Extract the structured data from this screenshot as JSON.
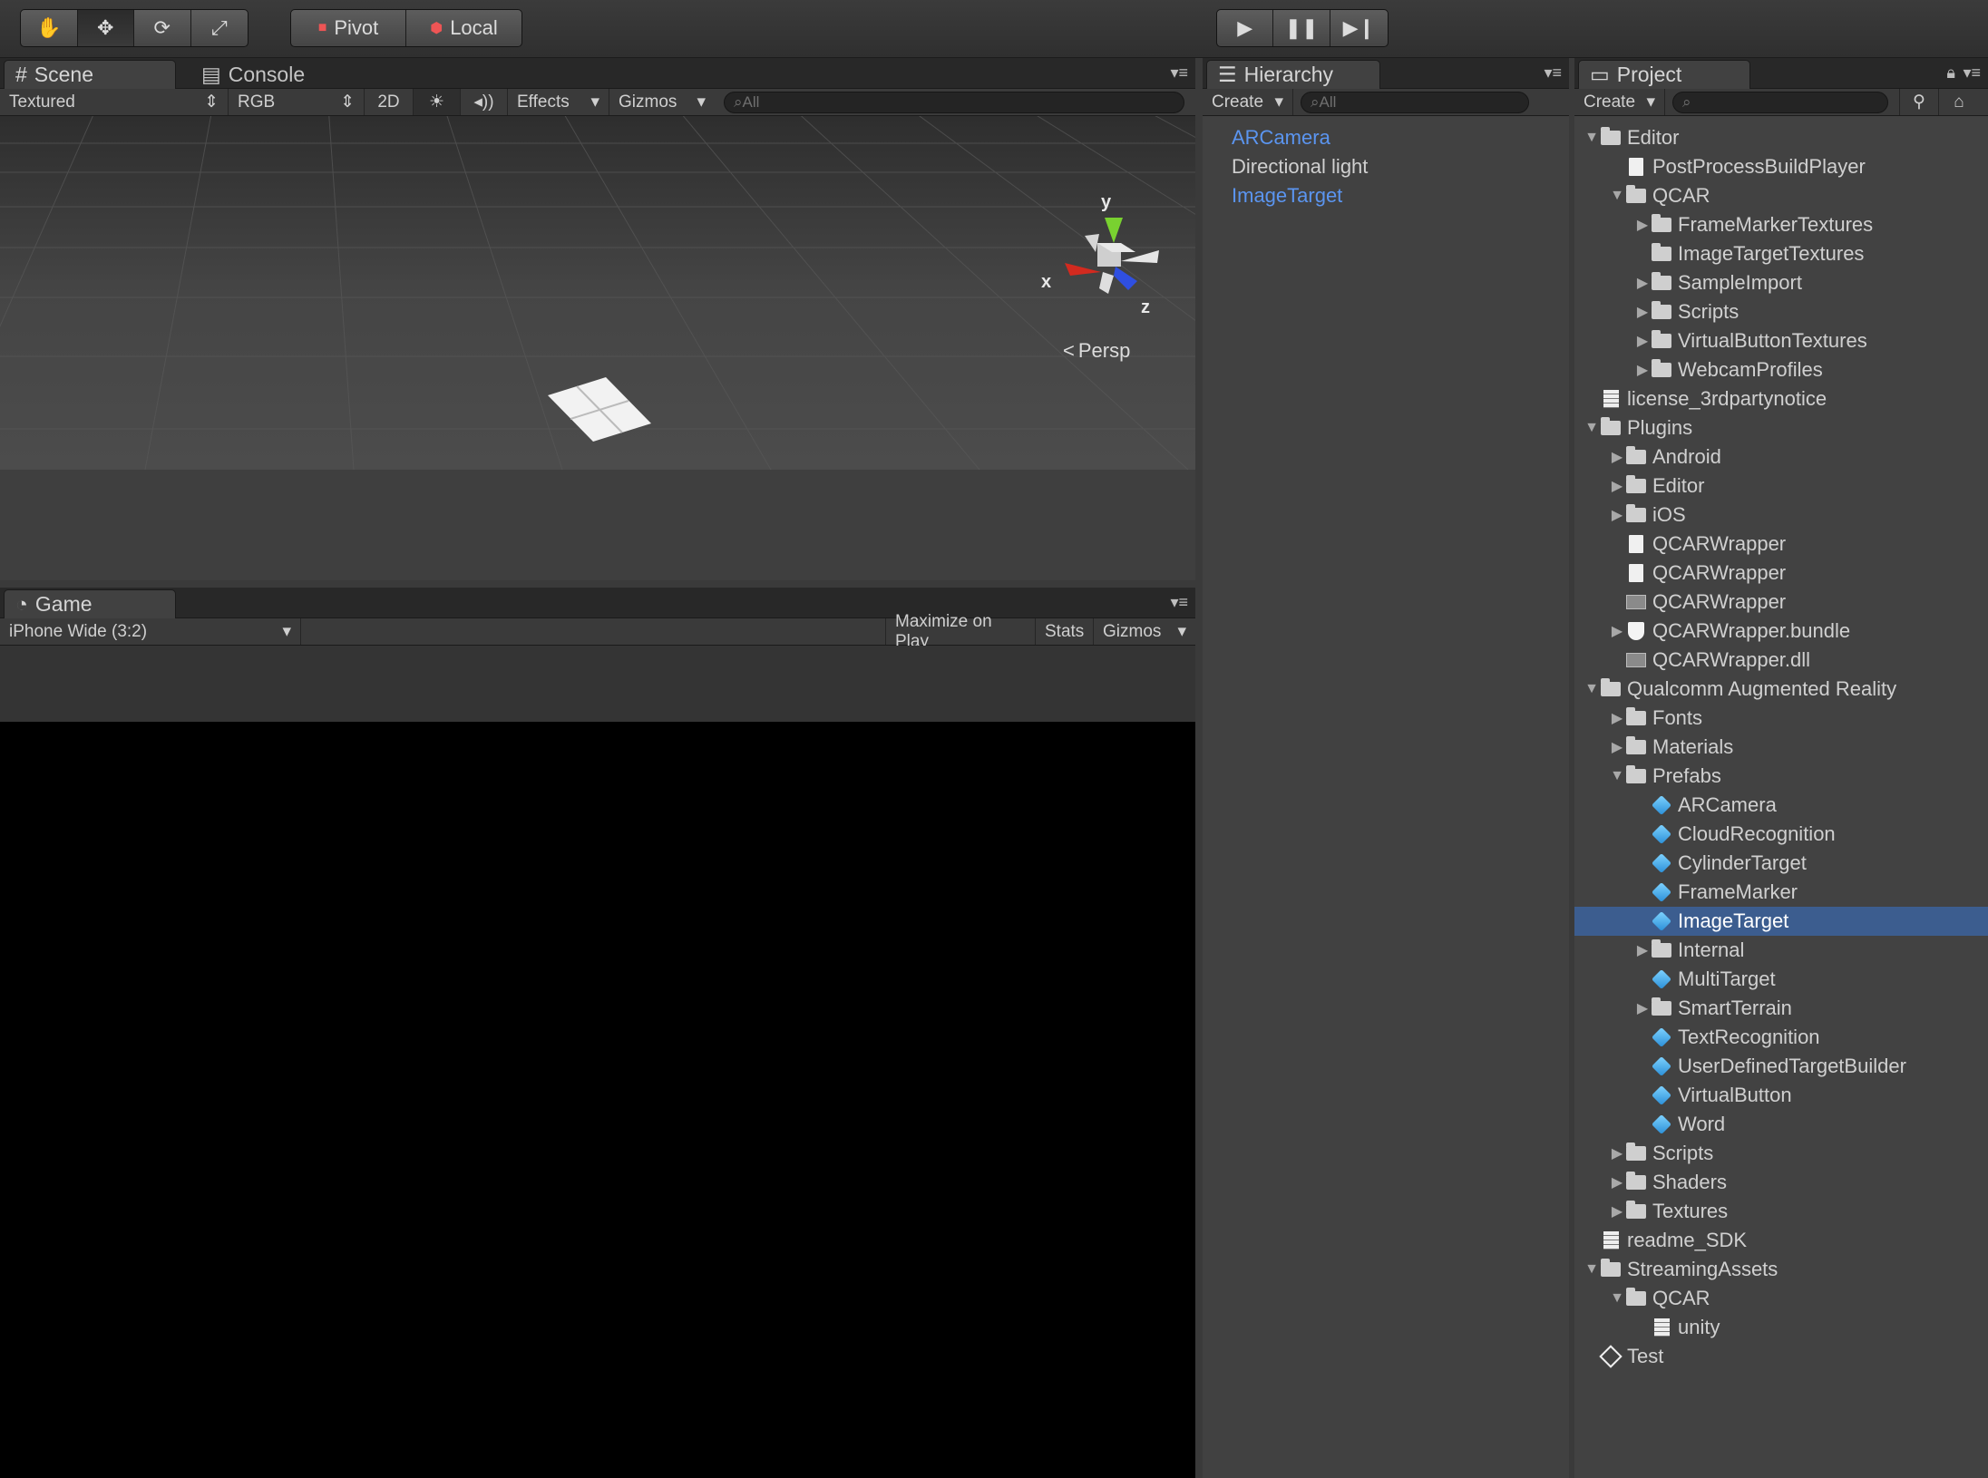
{
  "toolbar": {
    "transform_tools": [
      "hand-icon",
      "move-icon",
      "rotate-icon",
      "scale-icon"
    ],
    "pivot_label": "Pivot",
    "local_label": "Local",
    "play_controls": [
      "play-icon",
      "pause-icon",
      "step-icon"
    ]
  },
  "scene": {
    "tab_label": "Scene",
    "console_tab_label": "Console",
    "shading_mode": "Textured",
    "render_mode": "RGB",
    "toggle_2d": "2D",
    "effects_label": "Effects",
    "gizmos_label": "Gizmos",
    "search_placeholder": "All",
    "gizmo": {
      "x": "x",
      "y": "y",
      "z": "z"
    },
    "persp_label": "Persp"
  },
  "game": {
    "tab_label": "Game",
    "aspect": "iPhone Wide (3:2)",
    "maximize_label": "Maximize on Play",
    "stats_label": "Stats",
    "gizmos_label": "Gizmos"
  },
  "hierarchy": {
    "tab_label": "Hierarchy",
    "create_label": "Create",
    "search_placeholder": "All",
    "items": [
      {
        "label": "ARCamera",
        "prefab": true
      },
      {
        "label": "Directional light",
        "prefab": false
      },
      {
        "label": "ImageTarget",
        "prefab": true
      }
    ]
  },
  "project": {
    "tab_label": "Project",
    "create_label": "Create",
    "items": [
      {
        "label": "Editor",
        "depth": 0,
        "icon": "folder",
        "arrow": "open"
      },
      {
        "label": "PostProcessBuildPlayer",
        "depth": 1,
        "icon": "doc",
        "arrow": ""
      },
      {
        "label": "QCAR",
        "depth": 1,
        "icon": "folder",
        "arrow": "open"
      },
      {
        "label": "FrameMarkerTextures",
        "depth": 2,
        "icon": "folder",
        "arrow": "closed"
      },
      {
        "label": "ImageTargetTextures",
        "depth": 2,
        "icon": "folder",
        "arrow": ""
      },
      {
        "label": "SampleImport",
        "depth": 2,
        "icon": "folder",
        "arrow": "closed"
      },
      {
        "label": "Scripts",
        "depth": 2,
        "icon": "folder",
        "arrow": "closed"
      },
      {
        "label": "VirtualButtonTextures",
        "depth": 2,
        "icon": "folder",
        "arrow": "closed"
      },
      {
        "label": "WebcamProfiles",
        "depth": 2,
        "icon": "folder",
        "arrow": "closed"
      },
      {
        "label": "license_3rdpartynotice",
        "depth": 0,
        "icon": "txt",
        "arrow": ""
      },
      {
        "label": "Plugins",
        "depth": 0,
        "icon": "folder",
        "arrow": "open"
      },
      {
        "label": "Android",
        "depth": 1,
        "icon": "folder",
        "arrow": "closed"
      },
      {
        "label": "Editor",
        "depth": 1,
        "icon": "folder",
        "arrow": "closed"
      },
      {
        "label": "iOS",
        "depth": 1,
        "icon": "folder",
        "arrow": "closed"
      },
      {
        "label": "QCARWrapper",
        "depth": 1,
        "icon": "doc",
        "arrow": ""
      },
      {
        "label": "QCARWrapper",
        "depth": 1,
        "icon": "doc",
        "arrow": ""
      },
      {
        "label": "QCARWrapper",
        "depth": 1,
        "icon": "bin",
        "arrow": ""
      },
      {
        "label": "QCARWrapper.bundle",
        "depth": 1,
        "icon": "shield",
        "arrow": "closed"
      },
      {
        "label": "QCARWrapper.dll",
        "depth": 1,
        "icon": "bin",
        "arrow": ""
      },
      {
        "label": "Qualcomm Augmented Reality",
        "depth": 0,
        "icon": "folder",
        "arrow": "open"
      },
      {
        "label": "Fonts",
        "depth": 1,
        "icon": "folder",
        "arrow": "closed"
      },
      {
        "label": "Materials",
        "depth": 1,
        "icon": "folder",
        "arrow": "closed"
      },
      {
        "label": "Prefabs",
        "depth": 1,
        "icon": "folder",
        "arrow": "open"
      },
      {
        "label": "ARCamera",
        "depth": 2,
        "icon": "cube",
        "arrow": ""
      },
      {
        "label": "CloudRecognition",
        "depth": 2,
        "icon": "cube",
        "arrow": ""
      },
      {
        "label": "CylinderTarget",
        "depth": 2,
        "icon": "cube",
        "arrow": ""
      },
      {
        "label": "FrameMarker",
        "depth": 2,
        "icon": "cube",
        "arrow": ""
      },
      {
        "label": "ImageTarget",
        "depth": 2,
        "icon": "cube",
        "arrow": "",
        "selected": true
      },
      {
        "label": "Internal",
        "depth": 2,
        "icon": "folder",
        "arrow": "closed"
      },
      {
        "label": "MultiTarget",
        "depth": 2,
        "icon": "cube",
        "arrow": ""
      },
      {
        "label": "SmartTerrain",
        "depth": 2,
        "icon": "folder",
        "arrow": "closed"
      },
      {
        "label": "TextRecognition",
        "depth": 2,
        "icon": "cube",
        "arrow": ""
      },
      {
        "label": "UserDefinedTargetBuilder",
        "depth": 2,
        "icon": "cube",
        "arrow": ""
      },
      {
        "label": "VirtualButton",
        "depth": 2,
        "icon": "cube",
        "arrow": ""
      },
      {
        "label": "Word",
        "depth": 2,
        "icon": "cube",
        "arrow": ""
      },
      {
        "label": "Scripts",
        "depth": 1,
        "icon": "folder",
        "arrow": "closed"
      },
      {
        "label": "Shaders",
        "depth": 1,
        "icon": "folder",
        "arrow": "closed"
      },
      {
        "label": "Textures",
        "depth": 1,
        "icon": "folder",
        "arrow": "closed"
      },
      {
        "label": "readme_SDK",
        "depth": 0,
        "icon": "txt",
        "arrow": ""
      },
      {
        "label": "StreamingAssets",
        "depth": 0,
        "icon": "folder",
        "arrow": "open"
      },
      {
        "label": "QCAR",
        "depth": 1,
        "icon": "folder",
        "arrow": "open"
      },
      {
        "label": "unity",
        "depth": 2,
        "icon": "txt",
        "arrow": ""
      },
      {
        "label": "Test",
        "depth": 0,
        "icon": "unity",
        "arrow": ""
      }
    ]
  },
  "colors": {
    "selection": "#3c5d8f",
    "prefab_text": "#5b95f0",
    "panel": "#464646"
  }
}
